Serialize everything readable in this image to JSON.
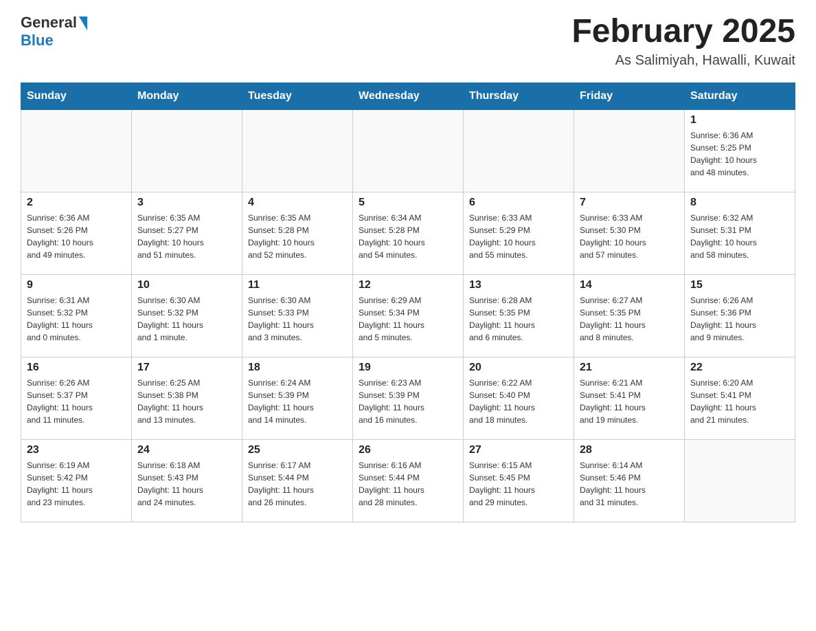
{
  "header": {
    "logo_general": "General",
    "logo_blue": "Blue",
    "month_title": "February 2025",
    "location": "As Salimiyah, Hawalli, Kuwait"
  },
  "days_of_week": [
    "Sunday",
    "Monday",
    "Tuesday",
    "Wednesday",
    "Thursday",
    "Friday",
    "Saturday"
  ],
  "weeks": [
    [
      {
        "day": "",
        "info": ""
      },
      {
        "day": "",
        "info": ""
      },
      {
        "day": "",
        "info": ""
      },
      {
        "day": "",
        "info": ""
      },
      {
        "day": "",
        "info": ""
      },
      {
        "day": "",
        "info": ""
      },
      {
        "day": "1",
        "info": "Sunrise: 6:36 AM\nSunset: 5:25 PM\nDaylight: 10 hours\nand 48 minutes."
      }
    ],
    [
      {
        "day": "2",
        "info": "Sunrise: 6:36 AM\nSunset: 5:26 PM\nDaylight: 10 hours\nand 49 minutes."
      },
      {
        "day": "3",
        "info": "Sunrise: 6:35 AM\nSunset: 5:27 PM\nDaylight: 10 hours\nand 51 minutes."
      },
      {
        "day": "4",
        "info": "Sunrise: 6:35 AM\nSunset: 5:28 PM\nDaylight: 10 hours\nand 52 minutes."
      },
      {
        "day": "5",
        "info": "Sunrise: 6:34 AM\nSunset: 5:28 PM\nDaylight: 10 hours\nand 54 minutes."
      },
      {
        "day": "6",
        "info": "Sunrise: 6:33 AM\nSunset: 5:29 PM\nDaylight: 10 hours\nand 55 minutes."
      },
      {
        "day": "7",
        "info": "Sunrise: 6:33 AM\nSunset: 5:30 PM\nDaylight: 10 hours\nand 57 minutes."
      },
      {
        "day": "8",
        "info": "Sunrise: 6:32 AM\nSunset: 5:31 PM\nDaylight: 10 hours\nand 58 minutes."
      }
    ],
    [
      {
        "day": "9",
        "info": "Sunrise: 6:31 AM\nSunset: 5:32 PM\nDaylight: 11 hours\nand 0 minutes."
      },
      {
        "day": "10",
        "info": "Sunrise: 6:30 AM\nSunset: 5:32 PM\nDaylight: 11 hours\nand 1 minute."
      },
      {
        "day": "11",
        "info": "Sunrise: 6:30 AM\nSunset: 5:33 PM\nDaylight: 11 hours\nand 3 minutes."
      },
      {
        "day": "12",
        "info": "Sunrise: 6:29 AM\nSunset: 5:34 PM\nDaylight: 11 hours\nand 5 minutes."
      },
      {
        "day": "13",
        "info": "Sunrise: 6:28 AM\nSunset: 5:35 PM\nDaylight: 11 hours\nand 6 minutes."
      },
      {
        "day": "14",
        "info": "Sunrise: 6:27 AM\nSunset: 5:35 PM\nDaylight: 11 hours\nand 8 minutes."
      },
      {
        "day": "15",
        "info": "Sunrise: 6:26 AM\nSunset: 5:36 PM\nDaylight: 11 hours\nand 9 minutes."
      }
    ],
    [
      {
        "day": "16",
        "info": "Sunrise: 6:26 AM\nSunset: 5:37 PM\nDaylight: 11 hours\nand 11 minutes."
      },
      {
        "day": "17",
        "info": "Sunrise: 6:25 AM\nSunset: 5:38 PM\nDaylight: 11 hours\nand 13 minutes."
      },
      {
        "day": "18",
        "info": "Sunrise: 6:24 AM\nSunset: 5:39 PM\nDaylight: 11 hours\nand 14 minutes."
      },
      {
        "day": "19",
        "info": "Sunrise: 6:23 AM\nSunset: 5:39 PM\nDaylight: 11 hours\nand 16 minutes."
      },
      {
        "day": "20",
        "info": "Sunrise: 6:22 AM\nSunset: 5:40 PM\nDaylight: 11 hours\nand 18 minutes."
      },
      {
        "day": "21",
        "info": "Sunrise: 6:21 AM\nSunset: 5:41 PM\nDaylight: 11 hours\nand 19 minutes."
      },
      {
        "day": "22",
        "info": "Sunrise: 6:20 AM\nSunset: 5:41 PM\nDaylight: 11 hours\nand 21 minutes."
      }
    ],
    [
      {
        "day": "23",
        "info": "Sunrise: 6:19 AM\nSunset: 5:42 PM\nDaylight: 11 hours\nand 23 minutes."
      },
      {
        "day": "24",
        "info": "Sunrise: 6:18 AM\nSunset: 5:43 PM\nDaylight: 11 hours\nand 24 minutes."
      },
      {
        "day": "25",
        "info": "Sunrise: 6:17 AM\nSunset: 5:44 PM\nDaylight: 11 hours\nand 26 minutes."
      },
      {
        "day": "26",
        "info": "Sunrise: 6:16 AM\nSunset: 5:44 PM\nDaylight: 11 hours\nand 28 minutes."
      },
      {
        "day": "27",
        "info": "Sunrise: 6:15 AM\nSunset: 5:45 PM\nDaylight: 11 hours\nand 29 minutes."
      },
      {
        "day": "28",
        "info": "Sunrise: 6:14 AM\nSunset: 5:46 PM\nDaylight: 11 hours\nand 31 minutes."
      },
      {
        "day": "",
        "info": ""
      }
    ]
  ]
}
